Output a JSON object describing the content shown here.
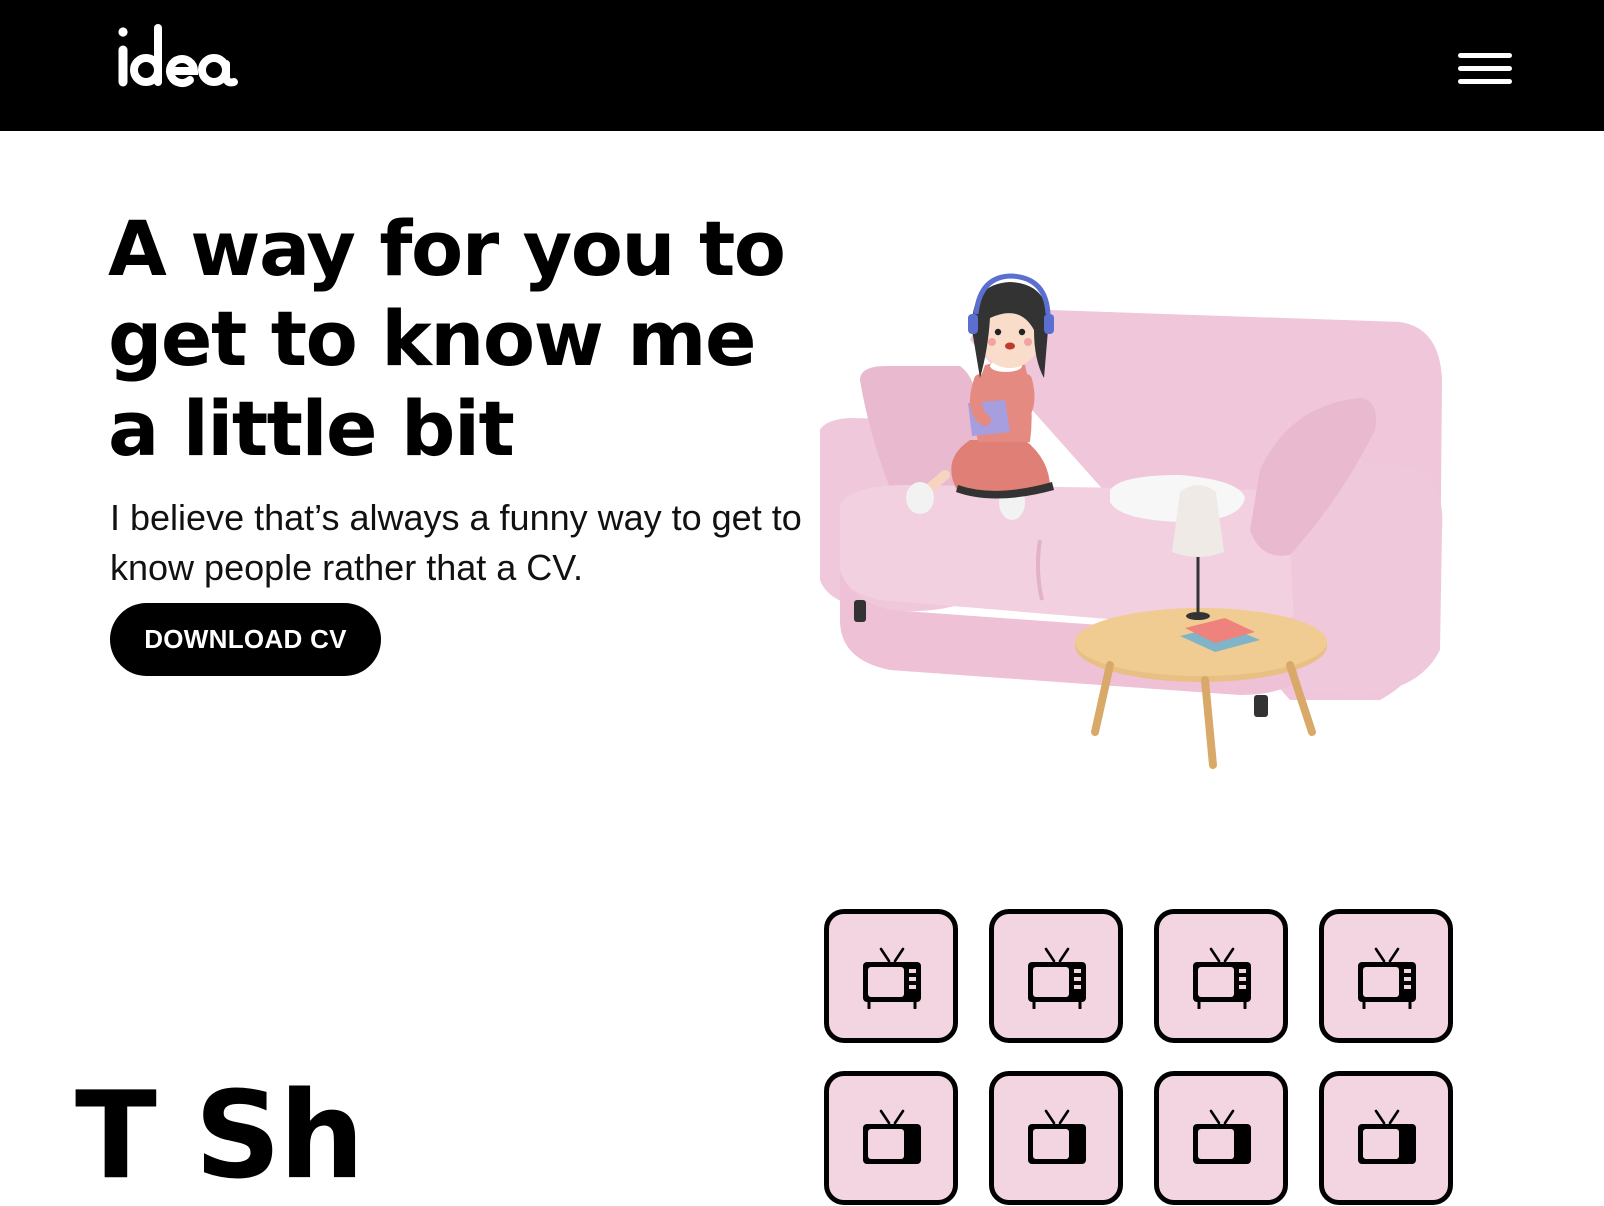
{
  "header": {
    "logo_text": "idea",
    "menu_icon": "hamburger-menu-icon",
    "background_color": "#000000"
  },
  "hero": {
    "title": "A way for you to get to know me a little bit",
    "subtitle": "I believe that’s always a funny way to get to know people rather that a CV.",
    "cta_label": "DOWNLOAD CV",
    "illustration": "girl-on-pink-sofa-3d-illustration"
  },
  "icon_grid": {
    "icon": "television-icon",
    "tile_color": "#f2d5e1",
    "tile_border_color": "#000000",
    "tiles": [
      "tv-1",
      "tv-2",
      "tv-3",
      "tv-4",
      "tv-5",
      "tv-6",
      "tv-7",
      "tv-8"
    ]
  },
  "section_heading": {
    "text": "T  Sh"
  },
  "colors": {
    "accent_pink": "#f2d5e1",
    "sofa_pink": "#efc6da",
    "text": "#000000",
    "button_bg": "#000000",
    "button_text": "#ffffff"
  }
}
